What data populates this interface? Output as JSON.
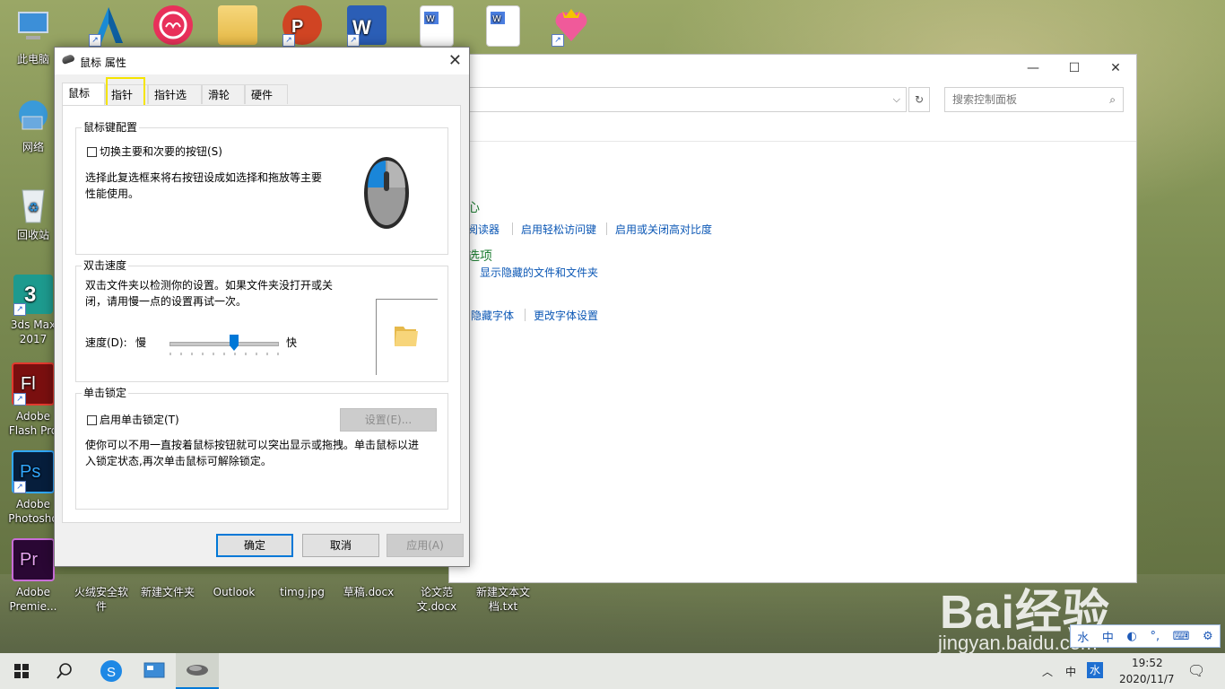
{
  "desktop": {
    "icons": [
      {
        "label": "此电脑"
      },
      {
        "label": "网络"
      },
      {
        "label": "回收站"
      },
      {
        "label": "3ds Max 2017"
      },
      {
        "label": "Adobe Flash Pro"
      },
      {
        "label": "Adobe Photosho"
      },
      {
        "label": "Adobe Premie..."
      },
      {
        "label": "火绒安全软件"
      },
      {
        "label": "新建文件夹"
      },
      {
        "label": "Outlook"
      },
      {
        "label": "timg.jpg"
      },
      {
        "label": "草稿.docx"
      },
      {
        "label": "论文范文.docx"
      },
      {
        "label": "新建文本文档.txt"
      }
    ]
  },
  "control_panel": {
    "search_placeholder": "搜索控制面板",
    "links": {
      "reader": "阅读器",
      "sticky_keys": "启用轻松访问键",
      "high_contrast": "启用或关闭高对比度",
      "options": "选项",
      "show_hidden": "显示隐藏的文件和文件夹",
      "hide_fonts": "隐藏字体",
      "change_font": "更改字体设置",
      "heart": "心"
    }
  },
  "dialog": {
    "title": "鼠标 属性",
    "tabs": [
      "鼠标键",
      "指针",
      "指针选项",
      "滑轮",
      "硬件"
    ],
    "active_tab": "鼠标键",
    "button_config": {
      "title": "鼠标键配置",
      "switch_label": "切换主要和次要的按钮(S)",
      "switch_checked": false,
      "description": [
        "选择此复选框来将右按钮设成如选择和拖放等主要",
        "性能使用。"
      ]
    },
    "double_click": {
      "title": "双击速度",
      "description": [
        "双击文件夹以检测你的设置。如果文件夹没打开或关",
        "闭，请用慢一点的设置再试一次。"
      ],
      "speed_label": "速度(D):",
      "slow": "慢",
      "fast": "快",
      "speed_fraction": 0.6
    },
    "click_lock": {
      "title": "单击锁定",
      "enable_label": "启用单击锁定(T)",
      "enabled": false,
      "settings_button": "设置(E)...",
      "description": [
        "使你可以不用一直按着鼠标按钮就可以突出显示或拖拽。单击鼠标以进",
        "入锁定状态,再次单击鼠标可解除锁定。"
      ]
    },
    "buttons": {
      "ok": "确定",
      "cancel": "取消",
      "apply": "应用(A)"
    }
  },
  "taskbar": {
    "ime_indicator": "中",
    "ime_mode": "水",
    "time": "19:52",
    "date": "2020/11/7"
  },
  "ime_toolbar": {
    "items": [
      "水",
      "中",
      "◐",
      "°,",
      "⌨",
      "⚙"
    ]
  },
  "watermark": {
    "main": "Bai经验",
    "sub": "jingyan.baidu.com"
  },
  "colors": {
    "accent": "#0078d7",
    "link": "#0b57b5",
    "highlight": "#f5e400"
  }
}
